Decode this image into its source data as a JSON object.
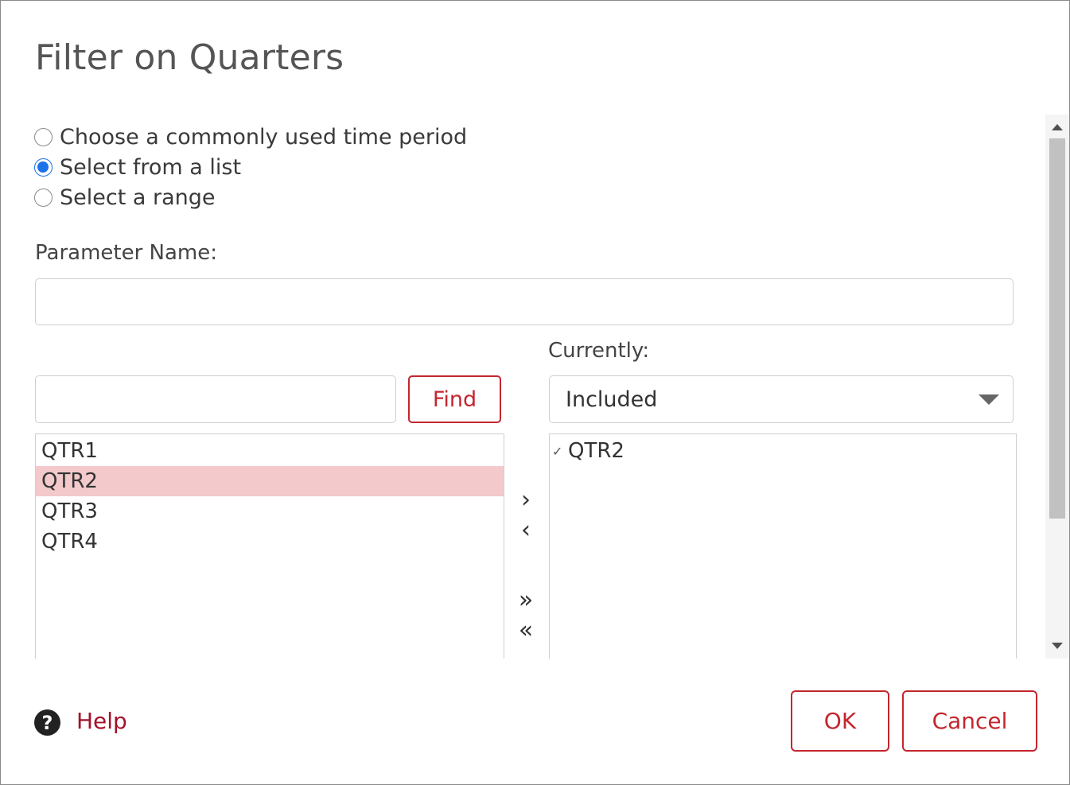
{
  "dialog": {
    "title": "Filter on Quarters"
  },
  "mode_options": [
    {
      "label": "Choose a commonly used time period",
      "checked": false
    },
    {
      "label": "Select from a list",
      "checked": true
    },
    {
      "label": "Select a range",
      "checked": false
    }
  ],
  "parameter": {
    "label": "Parameter Name:",
    "value": ""
  },
  "search": {
    "value": "",
    "find_label": "Find"
  },
  "currently": {
    "label": "Currently:",
    "selected": "Included"
  },
  "available_items": [
    {
      "label": "QTR1",
      "selected": false
    },
    {
      "label": "QTR2",
      "selected": true
    },
    {
      "label": "QTR3",
      "selected": false
    },
    {
      "label": "QTR4",
      "selected": false
    }
  ],
  "chosen_items": [
    {
      "label": "QTR2",
      "checked": true
    }
  ],
  "transfer_buttons": {
    "add": "›",
    "remove": "‹",
    "add_all": "»",
    "remove_all": "«"
  },
  "footer": {
    "help_label": "Help",
    "ok_label": "OK",
    "cancel_label": "Cancel"
  },
  "colors": {
    "accent": "#c4262e",
    "radio_checked": "#1a73e8",
    "selection_bg": "#f3c9cb",
    "help_link": "#a3102a"
  },
  "icons": {
    "help": "question-circle-icon",
    "dropdown": "caret-down-icon",
    "check": "checkmark-icon"
  }
}
